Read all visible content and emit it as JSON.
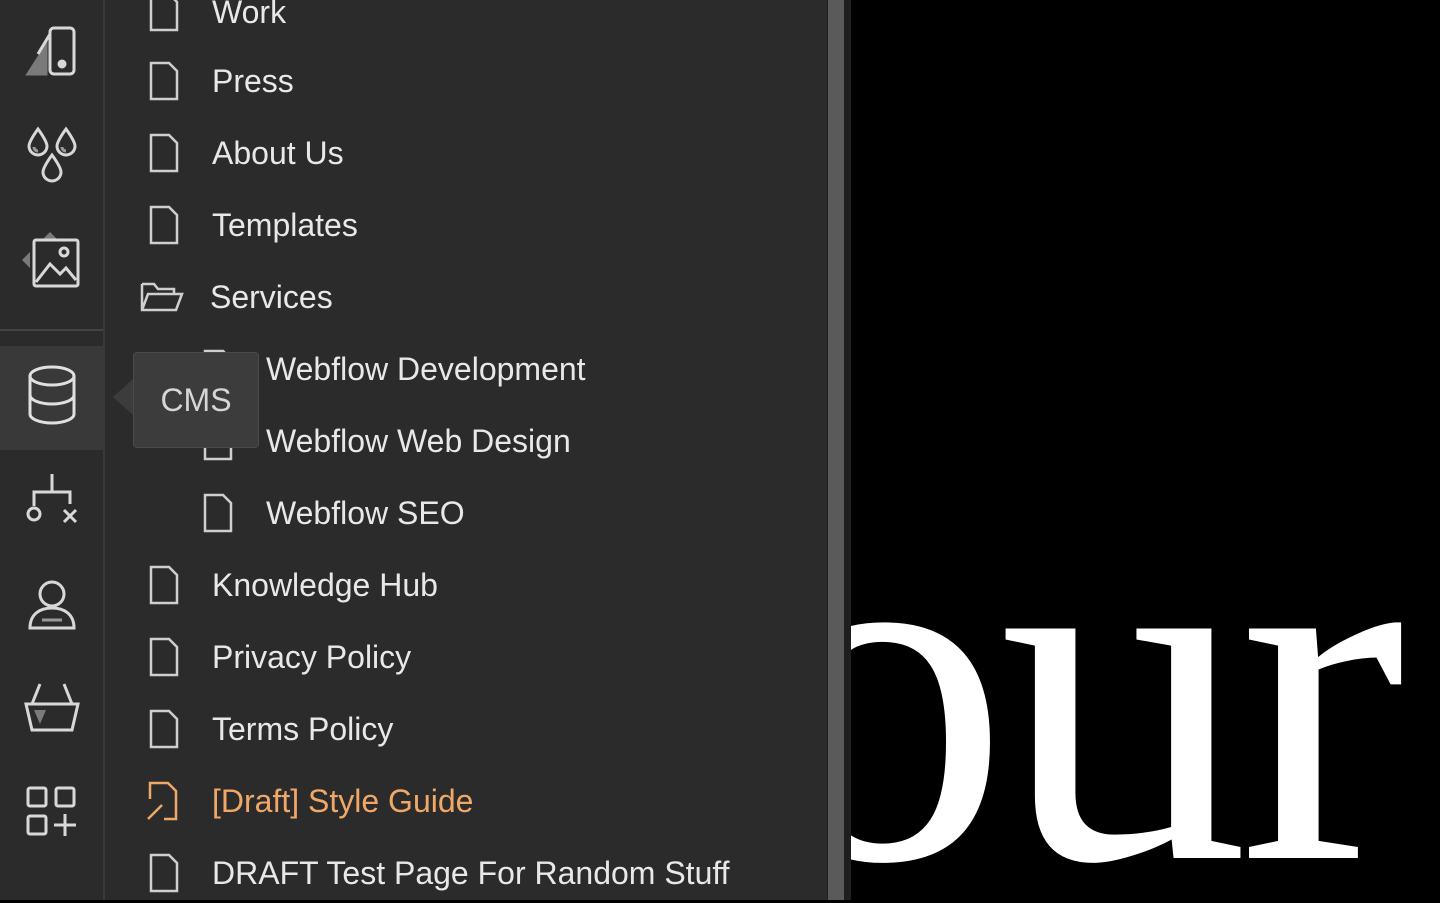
{
  "toolbar": {
    "items": [
      {
        "name": "style-guide-icon"
      },
      {
        "name": "variables-icon"
      },
      {
        "name": "assets-icon"
      },
      {
        "name": "cms-database-icon",
        "active": true
      },
      {
        "name": "logic-flow-icon"
      },
      {
        "name": "users-icon"
      },
      {
        "name": "ecommerce-basket-icon"
      },
      {
        "name": "apps-icon"
      }
    ],
    "tooltip": "CMS"
  },
  "pages": [
    {
      "label": "Work",
      "icon": "page-icon"
    },
    {
      "label": "Press",
      "icon": "page-icon"
    },
    {
      "label": "About Us",
      "icon": "page-icon"
    },
    {
      "label": "Templates",
      "icon": "page-icon"
    },
    {
      "label": "Services",
      "icon": "folder-open-icon"
    },
    {
      "label": "Webflow Development",
      "icon": "page-icon",
      "indent": 1
    },
    {
      "label": "Webflow Web Design",
      "icon": "page-icon",
      "indent": 1
    },
    {
      "label": "Webflow SEO",
      "icon": "page-icon",
      "indent": 1
    },
    {
      "label": "Knowledge Hub",
      "icon": "page-icon"
    },
    {
      "label": "Privacy Policy",
      "icon": "page-icon"
    },
    {
      "label": "Terms Policy",
      "icon": "page-icon"
    },
    {
      "label": "[Draft] Style Guide",
      "icon": "draft-page-icon",
      "draft": true
    },
    {
      "label": "DRAFT Test Page For Random Stuff",
      "icon": "page-icon"
    }
  ],
  "canvas": {
    "text": "our T"
  },
  "colors": {
    "panel_bg": "#2b2b2b",
    "draft_accent": "#f0a868",
    "text": "#e8e8e8"
  }
}
